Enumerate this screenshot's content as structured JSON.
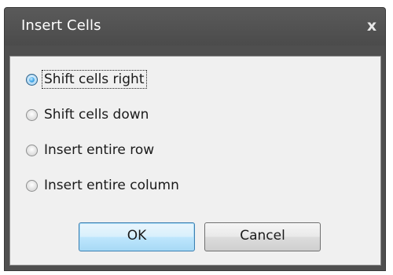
{
  "dialog": {
    "title": "Insert Cells",
    "close_glyph": "x",
    "close_icon": "close-icon"
  },
  "options": [
    {
      "label": "Shift cells right",
      "selected": true
    },
    {
      "label": "Shift cells down",
      "selected": false
    },
    {
      "label": "Insert entire row",
      "selected": false
    },
    {
      "label": "Insert entire column",
      "selected": false
    }
  ],
  "buttons": {
    "ok_label": "OK",
    "cancel_label": "Cancel"
  },
  "colors": {
    "frame": "#4f4f4f",
    "client": "#f0f0f0",
    "accent": "#3c7fb1"
  }
}
